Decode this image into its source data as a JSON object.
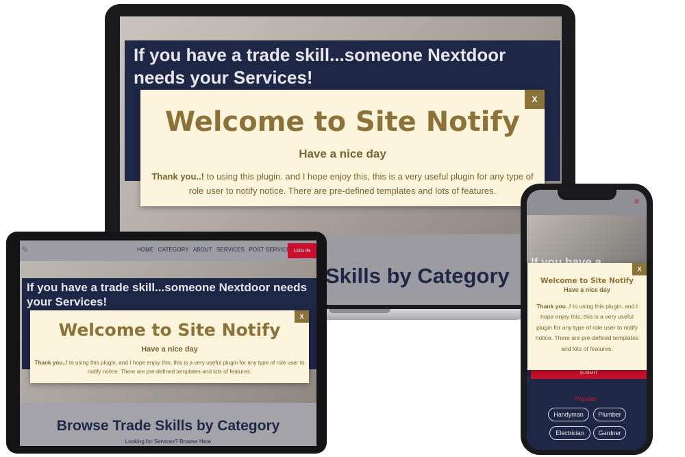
{
  "popup": {
    "title": "Welcome to Site Notify",
    "subtitle": "Have a nice day",
    "body_bold": "Thank you..!",
    "body_text": " to using this plugin. and I hope enjoy this, this is a very useful plugin for any type of role user to notify notice. There are pre-defined templates and lots of features.",
    "close_label": "X"
  },
  "site": {
    "hero_headline": "If you have a trade skill...someone Nextdoor needs your Services!",
    "browse_heading_partial": "Skills by Category",
    "browse_heading": "Browse Trade Skills by Category",
    "browse_sub": "Looking for Services? Browse Here",
    "nav": [
      "HOME",
      "CATEGORY",
      "ABOUT",
      "SERVICES",
      "POST SERVICE REQUEST"
    ],
    "login_label": "LOG IN",
    "phone_headline_partial": "If you have a",
    "submit_label": "SUBMIT",
    "popular_label": "Popular:",
    "popular_tags": [
      "Handyman",
      "Plumber",
      "Electrician",
      "Gardner"
    ]
  },
  "colors": {
    "modal_bg": "#fdf4dc",
    "modal_accent": "#8a7238",
    "navy": "#1f2747",
    "brand_red": "#c8102e"
  }
}
